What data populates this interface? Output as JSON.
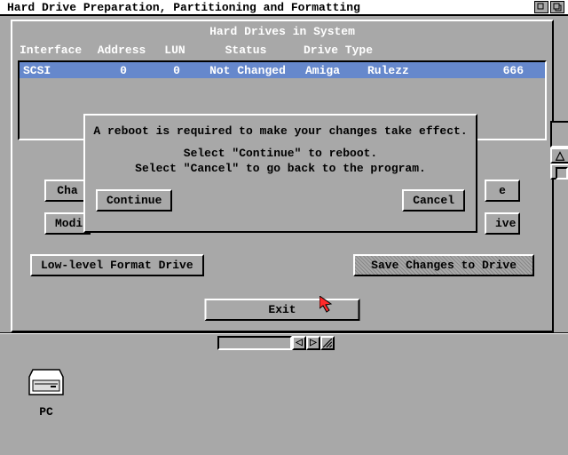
{
  "title": "Hard Drive Preparation, Partitioning and Formatting",
  "list_header": "Hard Drives in System",
  "columns": {
    "if": "Interface",
    "addr": "Address",
    "lun": "LUN",
    "status": "Status",
    "type": "Drive Type"
  },
  "row": {
    "if": "SCSI",
    "addr": "0",
    "lun": "0",
    "status": "Not Changed",
    "type1": "Amiga",
    "type2": "Rulezz",
    "num": "666"
  },
  "buttons": {
    "change": "Change Drive Type",
    "modify": "Modify",
    "right1": "e",
    "right2": "ive",
    "lowlevel": "Low-level Format Drive",
    "save": "Save Changes to Drive",
    "exit": "Exit"
  },
  "dialog": {
    "line1": "A reboot is required to make your changes take effect.",
    "line2": "Select \"Continue\" to reboot.",
    "line3": "Select \"Cancel\" to go back to the program.",
    "continue": "Continue",
    "cancel": "Cancel"
  },
  "desktop": {
    "pc_label": "PC"
  },
  "arrows": {
    "up": "△",
    "down": "▽",
    "left": "◁",
    "right": "▷"
  }
}
